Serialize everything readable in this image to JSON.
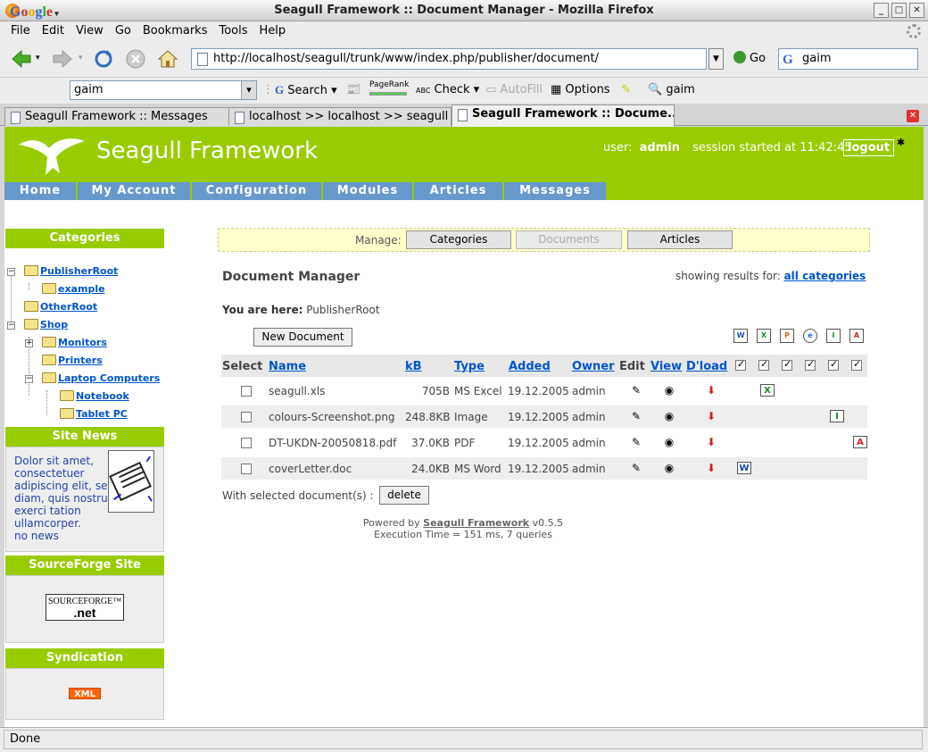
{
  "window": {
    "title": "Seagull Framework :: Document Manager - Mozilla Firefox",
    "buttons": [
      "_",
      "□",
      "✕"
    ]
  },
  "menu": [
    "File",
    "Edit",
    "View",
    "Go",
    "Bookmarks",
    "Tools",
    "Help"
  ],
  "nav": {
    "url": "http://localhost/seagull/trunk/www/index.php/publisher/document/",
    "go_label": "Go",
    "search_value": "gaim"
  },
  "google_toolbar": {
    "logo": "Google",
    "query": "gaim",
    "search_label": "Search",
    "pagerank_label": "PageRank",
    "check_label": "Check",
    "autofill_label": "AutoFill",
    "options_label": "Options",
    "highlight_word": "gaim"
  },
  "tabs": [
    {
      "label": "Seagull Framework :: Messages"
    },
    {
      "label": "localhost >> localhost >> seagull ..."
    },
    {
      "label": "Seagull Framework :: Docume..."
    }
  ],
  "header": {
    "site_name": "Seagull Framework",
    "user_label": "user:",
    "username": "admin",
    "session_text": "session started at 11:42:45",
    "logout_label": "logout"
  },
  "navtabs": [
    "Home",
    "My Account",
    "Configuration",
    "Modules",
    "Articles",
    "Messages"
  ],
  "sidebar": {
    "categories_title": "Categories",
    "tree": [
      "PublisherRoot",
      "example",
      "OtherRoot",
      "Shop",
      "Monitors",
      "Printers",
      "Laptop Computers",
      "Notebook",
      "Tablet PC"
    ],
    "news_title": "Site News",
    "news_text": "Dolor sit amet, consectetuer adipiscing elit, sed diam, quis nostrud exerci tation ullamcorper.",
    "news_empty": "no news",
    "sf_title": "SourceForge Site",
    "sf_logo_top": "SOURCEFORGE™",
    "sf_logo_bottom": ".net",
    "syndication_title": "Syndication",
    "xml_label": "XML"
  },
  "manage": {
    "label": "Manage:",
    "buttons": [
      "Categories",
      "Documents",
      "Articles"
    ]
  },
  "main": {
    "title": "Document Manager",
    "showing_label": "showing results for:",
    "showing_link": "all categories",
    "here_label": "You are here:",
    "here_value": "PublisherRoot",
    "new_document_label": "New Document",
    "with_selected": "With selected document(s) :",
    "delete_label": "delete"
  },
  "filetype_icons": [
    "W",
    "X",
    "P",
    "e",
    "I",
    "A"
  ],
  "table": {
    "headers": [
      "Select",
      "Name",
      "kB",
      "Type",
      "Added",
      "Owner",
      "Edit",
      "View",
      "D'load"
    ],
    "rows": [
      {
        "name": "seagull.xls",
        "kb": "705B",
        "type": "MS Excel",
        "added": "19.12.2005",
        "owner": "admin"
      },
      {
        "name": "colours-Screenshot.png",
        "kb": "248.8KB",
        "type": "Image",
        "added": "19.12.2005",
        "owner": "admin"
      },
      {
        "name": "DT-UKDN-20050818.pdf",
        "kb": "37.0KB",
        "type": "PDF",
        "added": "19.12.2005",
        "owner": "admin"
      },
      {
        "name": "coverLetter.doc",
        "kb": "24.0KB",
        "type": "MS Word",
        "added": "19.12.2005",
        "owner": "admin"
      }
    ]
  },
  "footer": {
    "powered_by": "Powered by",
    "powered_link": "Seagull Framework",
    "version": "v0.5.5",
    "exec_time": "Execution Time = 151 ms, 7 queries"
  },
  "status": "Done"
}
